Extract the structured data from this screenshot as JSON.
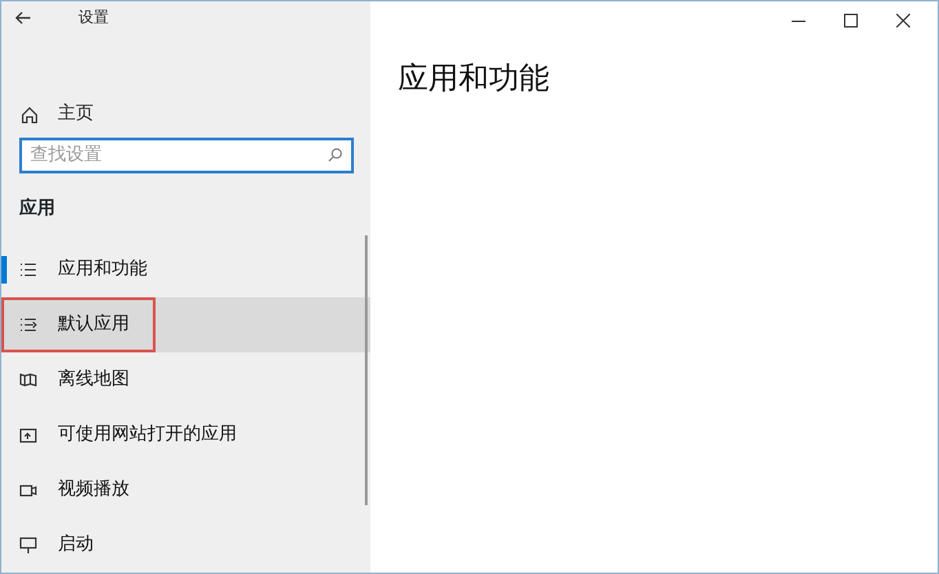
{
  "window": {
    "title": "设置"
  },
  "sidebar": {
    "home": "主页",
    "search": {
      "placeholder": "查找设置"
    },
    "section": "应用",
    "items": [
      {
        "label": "应用和功能",
        "selected": true,
        "hovered": false,
        "outlined": false
      },
      {
        "label": "默认应用",
        "selected": false,
        "hovered": true,
        "outlined": true
      },
      {
        "label": "离线地图",
        "selected": false,
        "hovered": false,
        "outlined": false
      },
      {
        "label": "可使用网站打开的应用",
        "selected": false,
        "hovered": false,
        "outlined": false
      },
      {
        "label": "视频播放",
        "selected": false,
        "hovered": false,
        "outlined": false
      },
      {
        "label": "启动",
        "selected": false,
        "hovered": false,
        "outlined": false
      }
    ]
  },
  "page": {
    "title": "应用和功能"
  }
}
